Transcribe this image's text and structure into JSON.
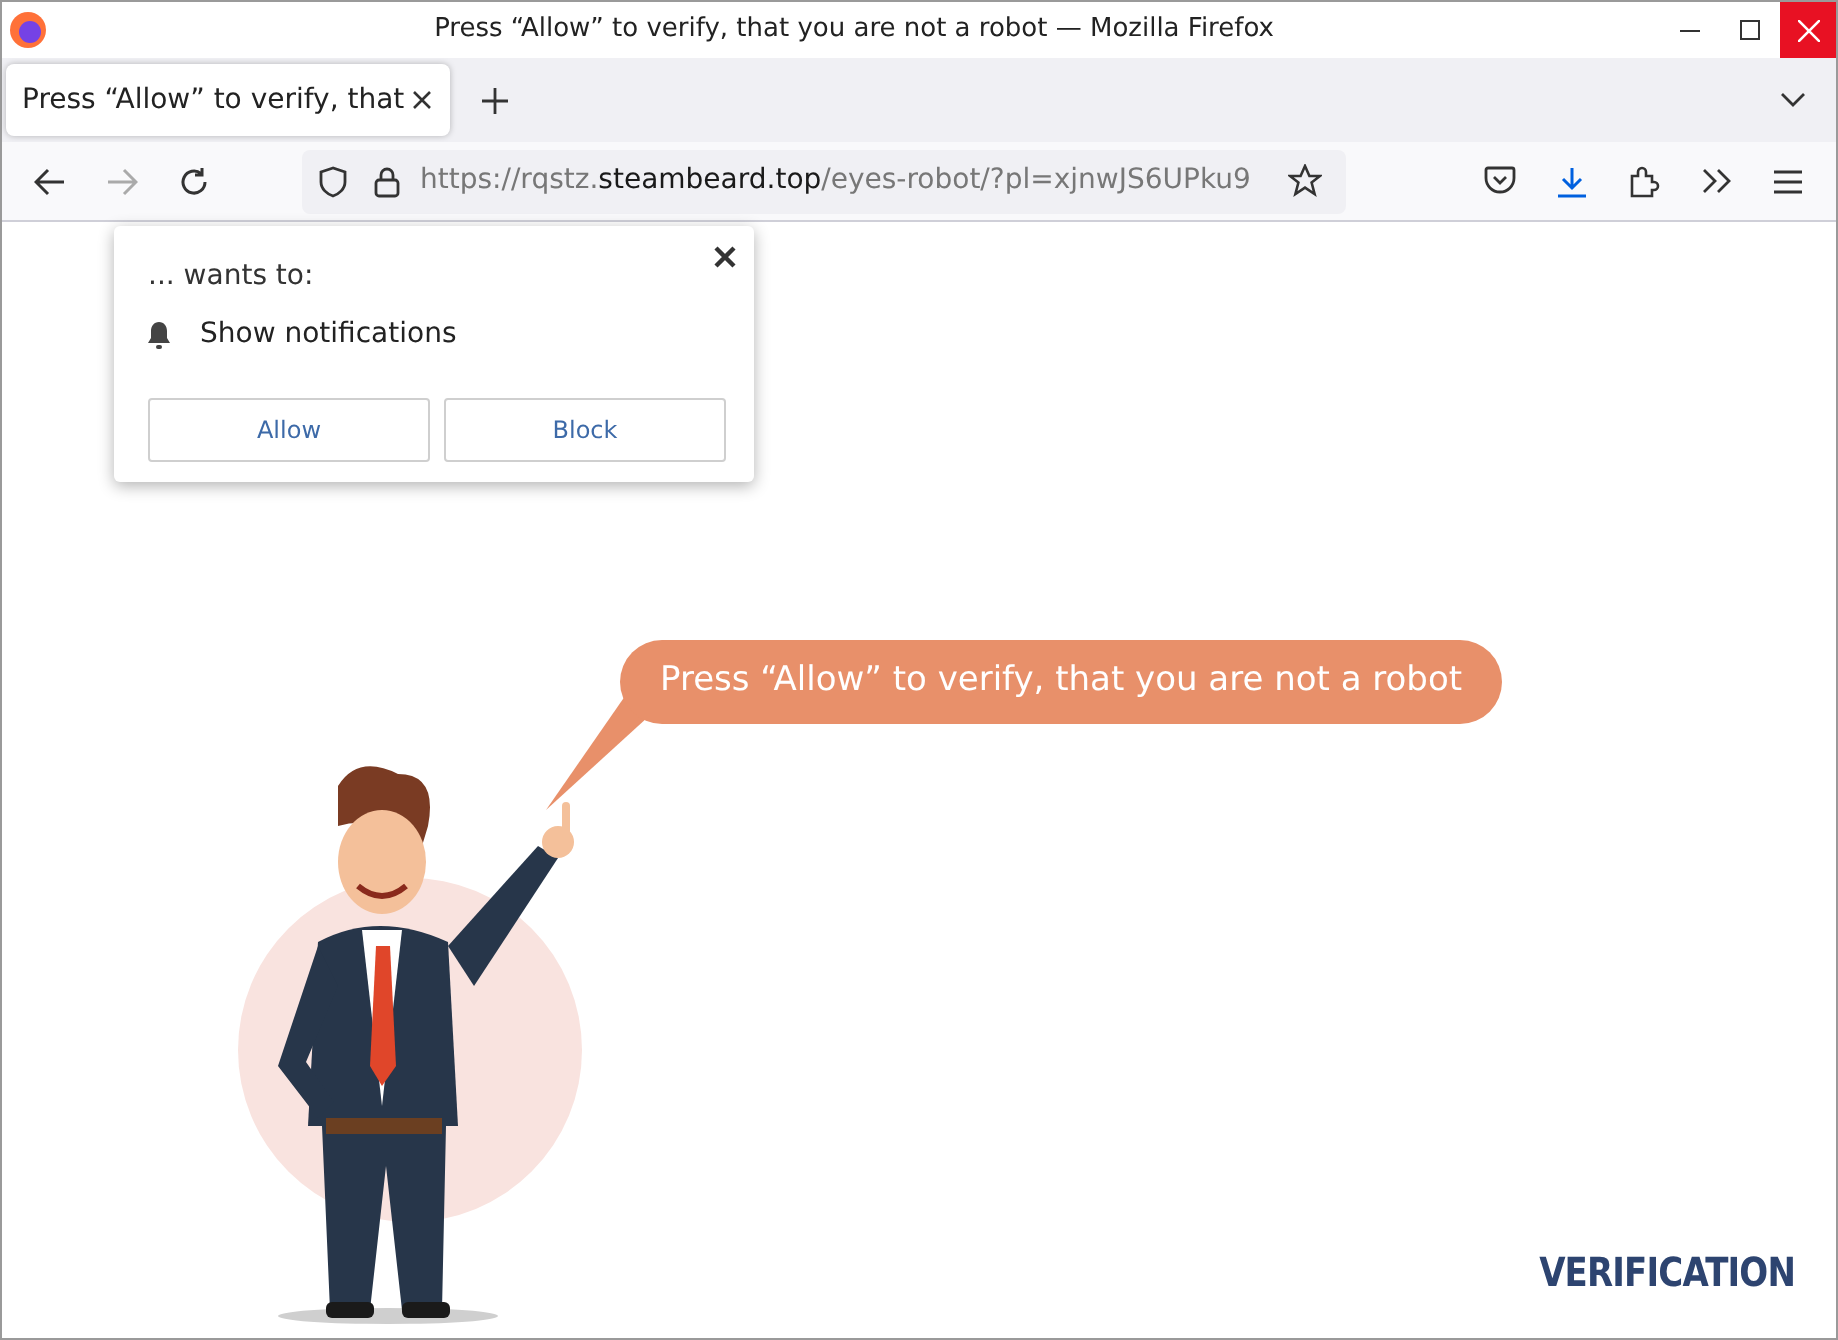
{
  "window": {
    "title": "Press “Allow” to verify, that you are not a robot — Mozilla Firefox"
  },
  "tabs": [
    {
      "label": "Press “Allow” to verify, that",
      "selected": true
    }
  ],
  "address_bar": {
    "prefix": "https://rqstz.",
    "domain": "steambeard.top",
    "suffix": "/eyes-robot/?pl=xjnwJS6UPku9"
  },
  "permission_popup": {
    "heading": "... wants to:",
    "permission": "Show notifications",
    "buttons": [
      "Allow",
      "Block"
    ]
  },
  "page": {
    "speech_bubble": "Press “Allow” to verify, that you are not a robot",
    "footer_label": "VERIFICATION"
  }
}
